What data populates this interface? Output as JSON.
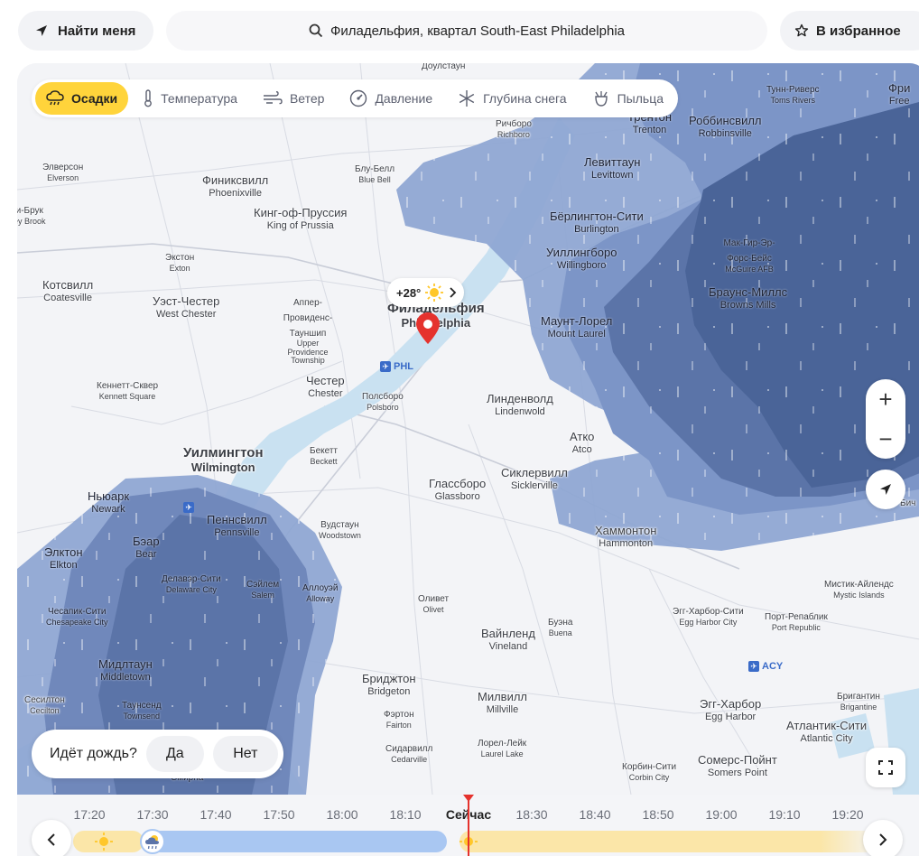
{
  "header": {
    "find_me": "Найти меня",
    "search_text": "Филадельфия, квартал South-East Philadelphia",
    "favorites": "В избранное"
  },
  "layers": [
    {
      "label": "Осадки",
      "icon": "precipitation-icon",
      "active": true
    },
    {
      "label": "Температура",
      "icon": "thermometer-icon",
      "active": false
    },
    {
      "label": "Ветер",
      "icon": "wind-icon",
      "active": false
    },
    {
      "label": "Давление",
      "icon": "pressure-icon",
      "active": false
    },
    {
      "label": "Глубина снега",
      "icon": "snowflake-icon",
      "active": false
    },
    {
      "label": "Пыльца",
      "icon": "pollen-icon",
      "active": false
    }
  ],
  "location_chip": {
    "temp": "+28°",
    "icon": "sun-icon"
  },
  "airports": [
    "PHL",
    "ACY"
  ],
  "cities": [
    {
      "ru": "Доулстаун",
      "en": ""
    },
    {
      "ru": "Тунн-Риверс",
      "en": "Toms Rivers"
    },
    {
      "ru": "Фри",
      "en": "Free"
    },
    {
      "ru": "Ричборо",
      "en": "Richboro"
    },
    {
      "ru": "Трентон",
      "en": "Trenton"
    },
    {
      "ru": "Роббинсвилл",
      "en": "Robbinsville"
    },
    {
      "ru": "Элверсон",
      "en": "Elverson"
    },
    {
      "ru": "Блу-Белл",
      "en": "Blue Bell"
    },
    {
      "ru": "Левиттаун",
      "en": "Levittown"
    },
    {
      "ru": "Финиксвилл",
      "en": "Phoenixville"
    },
    {
      "ru": "и-Брук",
      "en": "ey Brook"
    },
    {
      "ru": "Кинг-оф-Пруссия",
      "en": "King of Prussia"
    },
    {
      "ru": "Бёрлингтон-Сити",
      "en": "Burlington"
    },
    {
      "ru": "Мак-Гир-Эр-Форс-Бейс",
      "en": "McGuire AFB"
    },
    {
      "ru": "Экстон",
      "en": "Exton"
    },
    {
      "ru": "Уиллингборо",
      "en": "Willingboro"
    },
    {
      "ru": "Котсвилл",
      "en": "Coatesville"
    },
    {
      "ru": "Уэст-Честер",
      "en": "West Chester"
    },
    {
      "ru": "Аппер-Провиденс-Тауншип",
      "en": "Upper Providence Township"
    },
    {
      "ru": "Филадельфия",
      "en": "Philadelphia"
    },
    {
      "ru": "Браунс-Миллс",
      "en": "Browns Mills"
    },
    {
      "ru": "Маунт-Лорел",
      "en": "Mount Laurel"
    },
    {
      "ru": "Кеннетт-Сквер",
      "en": "Kennett Square"
    },
    {
      "ru": "Честер",
      "en": "Chester"
    },
    {
      "ru": "Полсборо",
      "en": "Polsboro"
    },
    {
      "ru": "Линденволд",
      "en": "Lindenwold"
    },
    {
      "ru": "Атко",
      "en": "Atco"
    },
    {
      "ru": "Уилмингтон",
      "en": "Wilmington"
    },
    {
      "ru": "Бекетт",
      "en": "Beckett"
    },
    {
      "ru": "Сиклервилл",
      "en": "Sicklerville"
    },
    {
      "ru": "Глассборо",
      "en": "Glassboro"
    },
    {
      "ru": "Ньюарк",
      "en": "Newark"
    },
    {
      "ru": "Пеннсвилл",
      "en": "Pennsville"
    },
    {
      "ru": "Вудстаун",
      "en": "Woodstown"
    },
    {
      "ru": "Хаммонтон",
      "en": "Hammonton"
    },
    {
      "ru": "Бэар",
      "en": "Bear"
    },
    {
      "ru": "Элктон",
      "en": "Elkton"
    },
    {
      "ru": "Делавэр-Сити",
      "en": "Delaware City"
    },
    {
      "ru": "Сэйлем",
      "en": "Salem"
    },
    {
      "ru": "Аллоуэй",
      "en": "Alloway"
    },
    {
      "ru": "Мистик-Айлендс",
      "en": "Mystic Islands"
    },
    {
      "ru": "Оливет",
      "en": "Olivet"
    },
    {
      "ru": "Чесапик-Сити",
      "en": "Chesapeake City"
    },
    {
      "ru": "Эгг-Харбор-Сити",
      "en": "Egg Harbor City"
    },
    {
      "ru": "Порт-Репаблик",
      "en": "Port Republic"
    },
    {
      "ru": "Буэна",
      "en": "Buena"
    },
    {
      "ru": "Вайнленд",
      "en": "Vineland"
    },
    {
      "ru": "Мидлтаун",
      "en": "Middletown"
    },
    {
      "ru": "Бриджтон",
      "en": "Bridgeton"
    },
    {
      "ru": "Бригантин",
      "en": "Brigantine"
    },
    {
      "ru": "Сесилтон",
      "en": "Cecilton"
    },
    {
      "ru": "Таунсенд",
      "en": "Townsend"
    },
    {
      "ru": "Милвилл",
      "en": "Millville"
    },
    {
      "ru": "Эгг-Харбор",
      "en": "Egg Harbor"
    },
    {
      "ru": "Фэртон",
      "en": "Fairton"
    },
    {
      "ru": "Атлантик-Сити",
      "en": "Atlantic City"
    },
    {
      "ru": "Лорел-Лейк",
      "en": "Laurel Lake"
    },
    {
      "ru": "Сидарвилл",
      "en": "Cedarville"
    },
    {
      "ru": "Корбин-Сити",
      "en": "Corbin City"
    },
    {
      "ru": "Сомерс-Пойнт",
      "en": "Somers Point"
    },
    {
      "ru": "Бич",
      "en": ""
    },
    {
      "ru": "Смирна",
      "en": ""
    }
  ],
  "rain_question": {
    "text": "Идёт дождь?",
    "yes": "Да",
    "no": "Нет"
  },
  "timeline": {
    "ticks": [
      "17:20",
      "17:30",
      "17:40",
      "17:50",
      "18:00",
      "18:10",
      "Сейчас",
      "18:30",
      "18:40",
      "18:50",
      "19:00",
      "19:10",
      "19:20"
    ],
    "colors": {
      "sun": "#fbe6a8",
      "rain": "#a9c7f2",
      "now": "#e5322d"
    }
  },
  "colors": {
    "accent": "#ffd43b",
    "precip_light": "#8fa6d3",
    "precip_dark": "#4a6498",
    "pin": "#e5322d"
  }
}
